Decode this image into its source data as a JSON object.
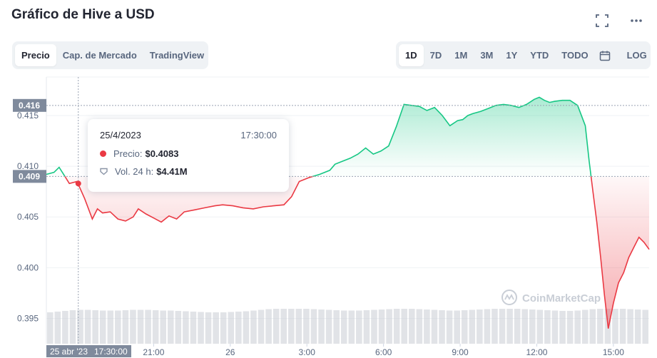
{
  "title": "Gráfico de Hive a USD",
  "header_icons": [
    "expand-icon",
    "more-icon"
  ],
  "view_tabs": [
    {
      "label": "Precio",
      "active": true
    },
    {
      "label": "Cap. de Mercado",
      "active": false
    },
    {
      "label": "TradingView",
      "active": false
    }
  ],
  "range_tabs": [
    {
      "label": "1D",
      "active": true
    },
    {
      "label": "7D",
      "active": false
    },
    {
      "label": "1M",
      "active": false
    },
    {
      "label": "3M",
      "active": false
    },
    {
      "label": "1Y",
      "active": false
    },
    {
      "label": "YTD",
      "active": false
    },
    {
      "label": "TODO",
      "active": false
    }
  ],
  "log_label": "LOG",
  "tooltip": {
    "date": "25/4/2023",
    "time": "17:30:00",
    "price_label": "Precio:",
    "price_value": "$0.4083",
    "volume_label": "Vol. 24 h:",
    "volume_value": "$4.41M"
  },
  "watermark": "CoinMarketCap",
  "colors": {
    "up": "#16c784",
    "down": "#ea3943",
    "reference_line": "#9aa3b3",
    "volume_bars": "#c8ccd3",
    "badge": "#7f8a9c"
  },
  "chart_data": {
    "type": "line",
    "reference_price": 0.409,
    "price_badges": [
      "0.416",
      "0.409"
    ],
    "crosshair_x_label": "25 abr '23",
    "crosshair_time_label": "17:30:00",
    "y_ticks": [
      "0.415",
      "0.410",
      "0.405",
      "0.400",
      "0.395"
    ],
    "y_tick_values": [
      0.415,
      0.41,
      0.405,
      0.4,
      0.395
    ],
    "ylim": [
      0.3925,
      0.4188
    ],
    "x_ticks": [
      {
        "label": "21:00",
        "t": 3.5
      },
      {
        "label": "26",
        "t": 6.5
      },
      {
        "label": "3:00",
        "t": 9.5
      },
      {
        "label": "6:00",
        "t": 12.5
      },
      {
        "label": "9:00",
        "t": 15.5
      },
      {
        "label": "12:00",
        "t": 18.5
      },
      {
        "label": "15:00",
        "t": 21.5
      }
    ],
    "x_unit": "hours since 25 abr '23 17:30:00",
    "xlim": [
      -0.7,
      22.9
    ],
    "series": [
      {
        "t": [
          -0.7,
          -0.4,
          -0.2,
          0,
          0.2,
          0.5,
          0.8,
          1.1,
          1.3,
          1.5,
          1.8,
          2.1,
          2.4,
          2.7,
          2.9,
          3.2,
          3.5,
          3.8,
          4.1,
          4.4,
          4.7,
          5.1,
          5.5,
          5.9,
          6.2,
          6.6,
          7.0,
          7.4,
          7.8,
          8.2,
          8.6,
          8.9,
          9.2,
          9.6,
          10.0,
          10.4,
          10.6,
          10.9,
          11.2,
          11.5,
          11.8,
          12.1,
          12.4,
          12.7,
          13.0,
          13.3,
          13.6,
          13.9,
          14.2,
          14.5,
          14.8,
          15.1,
          15.4,
          15.6,
          15.8,
          16.0,
          16.3,
          16.6,
          16.9,
          17.2,
          17.5,
          17.8,
          18.1,
          18.4,
          18.6,
          18.8,
          19.0,
          19.2,
          19.5,
          19.8,
          20.1,
          20.4,
          20.55,
          20.7,
          20.85,
          21.0,
          21.15,
          21.3,
          21.5,
          21.7,
          21.9,
          22.1,
          22.3,
          22.5,
          22.7,
          22.9
        ],
        "price": [
          0.4092,
          0.4094,
          0.4099,
          0.4091,
          0.4083,
          0.4085,
          0.4068,
          0.4048,
          0.4058,
          0.4054,
          0.4055,
          0.4048,
          0.4046,
          0.405,
          0.4058,
          0.4053,
          0.4049,
          0.4045,
          0.4051,
          0.4048,
          0.4055,
          0.4057,
          0.4059,
          0.4061,
          0.4062,
          0.4061,
          0.4059,
          0.4058,
          0.406,
          0.4061,
          0.4062,
          0.407,
          0.4085,
          0.4089,
          0.4092,
          0.4096,
          0.4102,
          0.4105,
          0.4108,
          0.4112,
          0.4118,
          0.4112,
          0.4115,
          0.412,
          0.4139,
          0.4161,
          0.416,
          0.4159,
          0.4155,
          0.4158,
          0.415,
          0.414,
          0.4145,
          0.4146,
          0.415,
          0.4152,
          0.4154,
          0.4157,
          0.416,
          0.4161,
          0.416,
          0.4158,
          0.4161,
          0.4166,
          0.4168,
          0.4165,
          0.4163,
          0.4164,
          0.4165,
          0.4165,
          0.416,
          0.414,
          0.4105,
          0.4075,
          0.4045,
          0.401,
          0.3973,
          0.394,
          0.3965,
          0.3985,
          0.3995,
          0.401,
          0.402,
          0.403,
          0.4025,
          0.4018
        ]
      }
    ],
    "volume": {
      "level": "flat",
      "values": [
        0.9,
        0.92,
        0.94,
        0.96,
        0.97,
        0.97,
        0.96,
        0.95,
        0.95,
        0.95,
        0.96,
        0.97,
        0.97,
        0.97,
        0.96,
        0.95,
        0.95,
        0.94,
        0.93,
        0.92,
        0.91,
        0.9,
        0.9,
        0.9,
        0.91,
        0.92,
        0.93,
        0.95,
        0.97,
        0.99,
        1.0,
        1.0,
        1.0,
        1.0,
        1.0,
        0.99,
        0.98,
        0.97,
        0.96,
        0.95,
        0.95,
        0.95,
        0.96,
        0.97,
        0.98,
        0.99,
        1.0,
        1.0,
        1.0,
        0.99,
        0.98,
        0.97,
        0.96,
        0.95,
        0.95,
        0.96,
        0.97,
        0.98,
        0.99,
        1.0,
        1.0,
        1.0,
        1.0,
        0.99,
        0.98,
        0.97,
        0.96,
        0.95,
        0.94,
        0.94,
        0.95,
        0.97,
        0.99,
        1.0,
        1.0,
        1.0,
        1.0,
        0.99,
        0.98,
        0.97
      ]
    },
    "grid": true,
    "legend": "none"
  }
}
